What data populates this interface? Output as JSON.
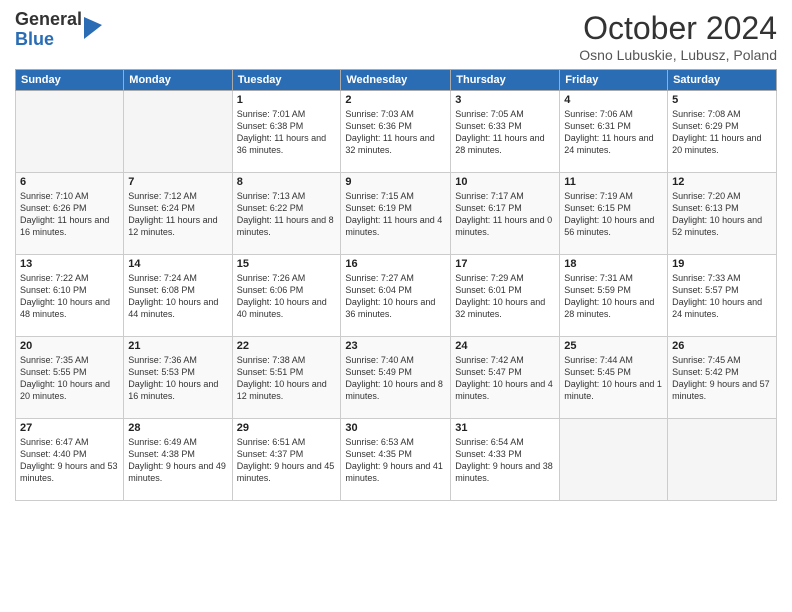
{
  "header": {
    "logo_line1": "General",
    "logo_line2": "Blue",
    "month": "October 2024",
    "location": "Osno Lubuskie, Lubusz, Poland"
  },
  "days_of_week": [
    "Sunday",
    "Monday",
    "Tuesday",
    "Wednesday",
    "Thursday",
    "Friday",
    "Saturday"
  ],
  "weeks": [
    [
      {
        "day": "",
        "info": ""
      },
      {
        "day": "",
        "info": ""
      },
      {
        "day": "1",
        "info": "Sunrise: 7:01 AM\nSunset: 6:38 PM\nDaylight: 11 hours and 36 minutes."
      },
      {
        "day": "2",
        "info": "Sunrise: 7:03 AM\nSunset: 6:36 PM\nDaylight: 11 hours and 32 minutes."
      },
      {
        "day": "3",
        "info": "Sunrise: 7:05 AM\nSunset: 6:33 PM\nDaylight: 11 hours and 28 minutes."
      },
      {
        "day": "4",
        "info": "Sunrise: 7:06 AM\nSunset: 6:31 PM\nDaylight: 11 hours and 24 minutes."
      },
      {
        "day": "5",
        "info": "Sunrise: 7:08 AM\nSunset: 6:29 PM\nDaylight: 11 hours and 20 minutes."
      }
    ],
    [
      {
        "day": "6",
        "info": "Sunrise: 7:10 AM\nSunset: 6:26 PM\nDaylight: 11 hours and 16 minutes."
      },
      {
        "day": "7",
        "info": "Sunrise: 7:12 AM\nSunset: 6:24 PM\nDaylight: 11 hours and 12 minutes."
      },
      {
        "day": "8",
        "info": "Sunrise: 7:13 AM\nSunset: 6:22 PM\nDaylight: 11 hours and 8 minutes."
      },
      {
        "day": "9",
        "info": "Sunrise: 7:15 AM\nSunset: 6:19 PM\nDaylight: 11 hours and 4 minutes."
      },
      {
        "day": "10",
        "info": "Sunrise: 7:17 AM\nSunset: 6:17 PM\nDaylight: 11 hours and 0 minutes."
      },
      {
        "day": "11",
        "info": "Sunrise: 7:19 AM\nSunset: 6:15 PM\nDaylight: 10 hours and 56 minutes."
      },
      {
        "day": "12",
        "info": "Sunrise: 7:20 AM\nSunset: 6:13 PM\nDaylight: 10 hours and 52 minutes."
      }
    ],
    [
      {
        "day": "13",
        "info": "Sunrise: 7:22 AM\nSunset: 6:10 PM\nDaylight: 10 hours and 48 minutes."
      },
      {
        "day": "14",
        "info": "Sunrise: 7:24 AM\nSunset: 6:08 PM\nDaylight: 10 hours and 44 minutes."
      },
      {
        "day": "15",
        "info": "Sunrise: 7:26 AM\nSunset: 6:06 PM\nDaylight: 10 hours and 40 minutes."
      },
      {
        "day": "16",
        "info": "Sunrise: 7:27 AM\nSunset: 6:04 PM\nDaylight: 10 hours and 36 minutes."
      },
      {
        "day": "17",
        "info": "Sunrise: 7:29 AM\nSunset: 6:01 PM\nDaylight: 10 hours and 32 minutes."
      },
      {
        "day": "18",
        "info": "Sunrise: 7:31 AM\nSunset: 5:59 PM\nDaylight: 10 hours and 28 minutes."
      },
      {
        "day": "19",
        "info": "Sunrise: 7:33 AM\nSunset: 5:57 PM\nDaylight: 10 hours and 24 minutes."
      }
    ],
    [
      {
        "day": "20",
        "info": "Sunrise: 7:35 AM\nSunset: 5:55 PM\nDaylight: 10 hours and 20 minutes."
      },
      {
        "day": "21",
        "info": "Sunrise: 7:36 AM\nSunset: 5:53 PM\nDaylight: 10 hours and 16 minutes."
      },
      {
        "day": "22",
        "info": "Sunrise: 7:38 AM\nSunset: 5:51 PM\nDaylight: 10 hours and 12 minutes."
      },
      {
        "day": "23",
        "info": "Sunrise: 7:40 AM\nSunset: 5:49 PM\nDaylight: 10 hours and 8 minutes."
      },
      {
        "day": "24",
        "info": "Sunrise: 7:42 AM\nSunset: 5:47 PM\nDaylight: 10 hours and 4 minutes."
      },
      {
        "day": "25",
        "info": "Sunrise: 7:44 AM\nSunset: 5:45 PM\nDaylight: 10 hours and 1 minute."
      },
      {
        "day": "26",
        "info": "Sunrise: 7:45 AM\nSunset: 5:42 PM\nDaylight: 9 hours and 57 minutes."
      }
    ],
    [
      {
        "day": "27",
        "info": "Sunrise: 6:47 AM\nSunset: 4:40 PM\nDaylight: 9 hours and 53 minutes."
      },
      {
        "day": "28",
        "info": "Sunrise: 6:49 AM\nSunset: 4:38 PM\nDaylight: 9 hours and 49 minutes."
      },
      {
        "day": "29",
        "info": "Sunrise: 6:51 AM\nSunset: 4:37 PM\nDaylight: 9 hours and 45 minutes."
      },
      {
        "day": "30",
        "info": "Sunrise: 6:53 AM\nSunset: 4:35 PM\nDaylight: 9 hours and 41 minutes."
      },
      {
        "day": "31",
        "info": "Sunrise: 6:54 AM\nSunset: 4:33 PM\nDaylight: 9 hours and 38 minutes."
      },
      {
        "day": "",
        "info": ""
      },
      {
        "day": "",
        "info": ""
      }
    ]
  ]
}
